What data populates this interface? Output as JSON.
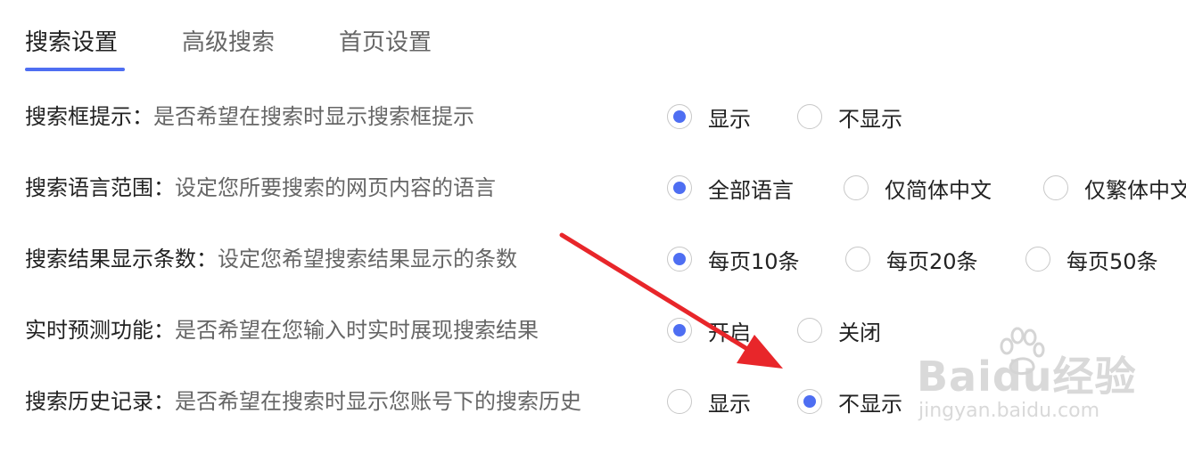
{
  "tabs": [
    {
      "label": "搜索设置"
    },
    {
      "label": "高级搜索"
    },
    {
      "label": "首页设置"
    }
  ],
  "rows": [
    {
      "title": "搜索框提示：",
      "desc": "是否希望在搜索时显示搜索框提示",
      "options": [
        {
          "label": "显示",
          "checked": true
        },
        {
          "label": "不显示",
          "checked": false
        }
      ]
    },
    {
      "title": "搜索语言范围：",
      "desc": "设定您所要搜索的网页内容的语言",
      "options": [
        {
          "label": "全部语言",
          "checked": true
        },
        {
          "label": "仅简体中文",
          "checked": false
        },
        {
          "label": "仅繁体中文",
          "checked": false
        }
      ]
    },
    {
      "title": "搜索结果显示条数：",
      "desc": "设定您希望搜索结果显示的条数",
      "options": [
        {
          "label": "每页10条",
          "checked": true
        },
        {
          "label": "每页20条",
          "checked": false
        },
        {
          "label": "每页50条",
          "checked": false
        }
      ]
    },
    {
      "title": "实时预测功能：",
      "desc": "是否希望在您输入时实时展现搜索结果",
      "options": [
        {
          "label": "开启",
          "checked": true
        },
        {
          "label": "关闭",
          "checked": false
        }
      ]
    },
    {
      "title": "搜索历史记录：",
      "desc": "是否希望在搜索时显示您账号下的搜索历史",
      "options": [
        {
          "label": "显示",
          "checked": false
        },
        {
          "label": "不显示",
          "checked": true
        }
      ]
    }
  ],
  "watermark": {
    "brand": "Baidu经验",
    "url": "jingyan.baidu.com"
  },
  "colors": {
    "accent": "#4e6ef2",
    "arrow": "#e8262a"
  }
}
